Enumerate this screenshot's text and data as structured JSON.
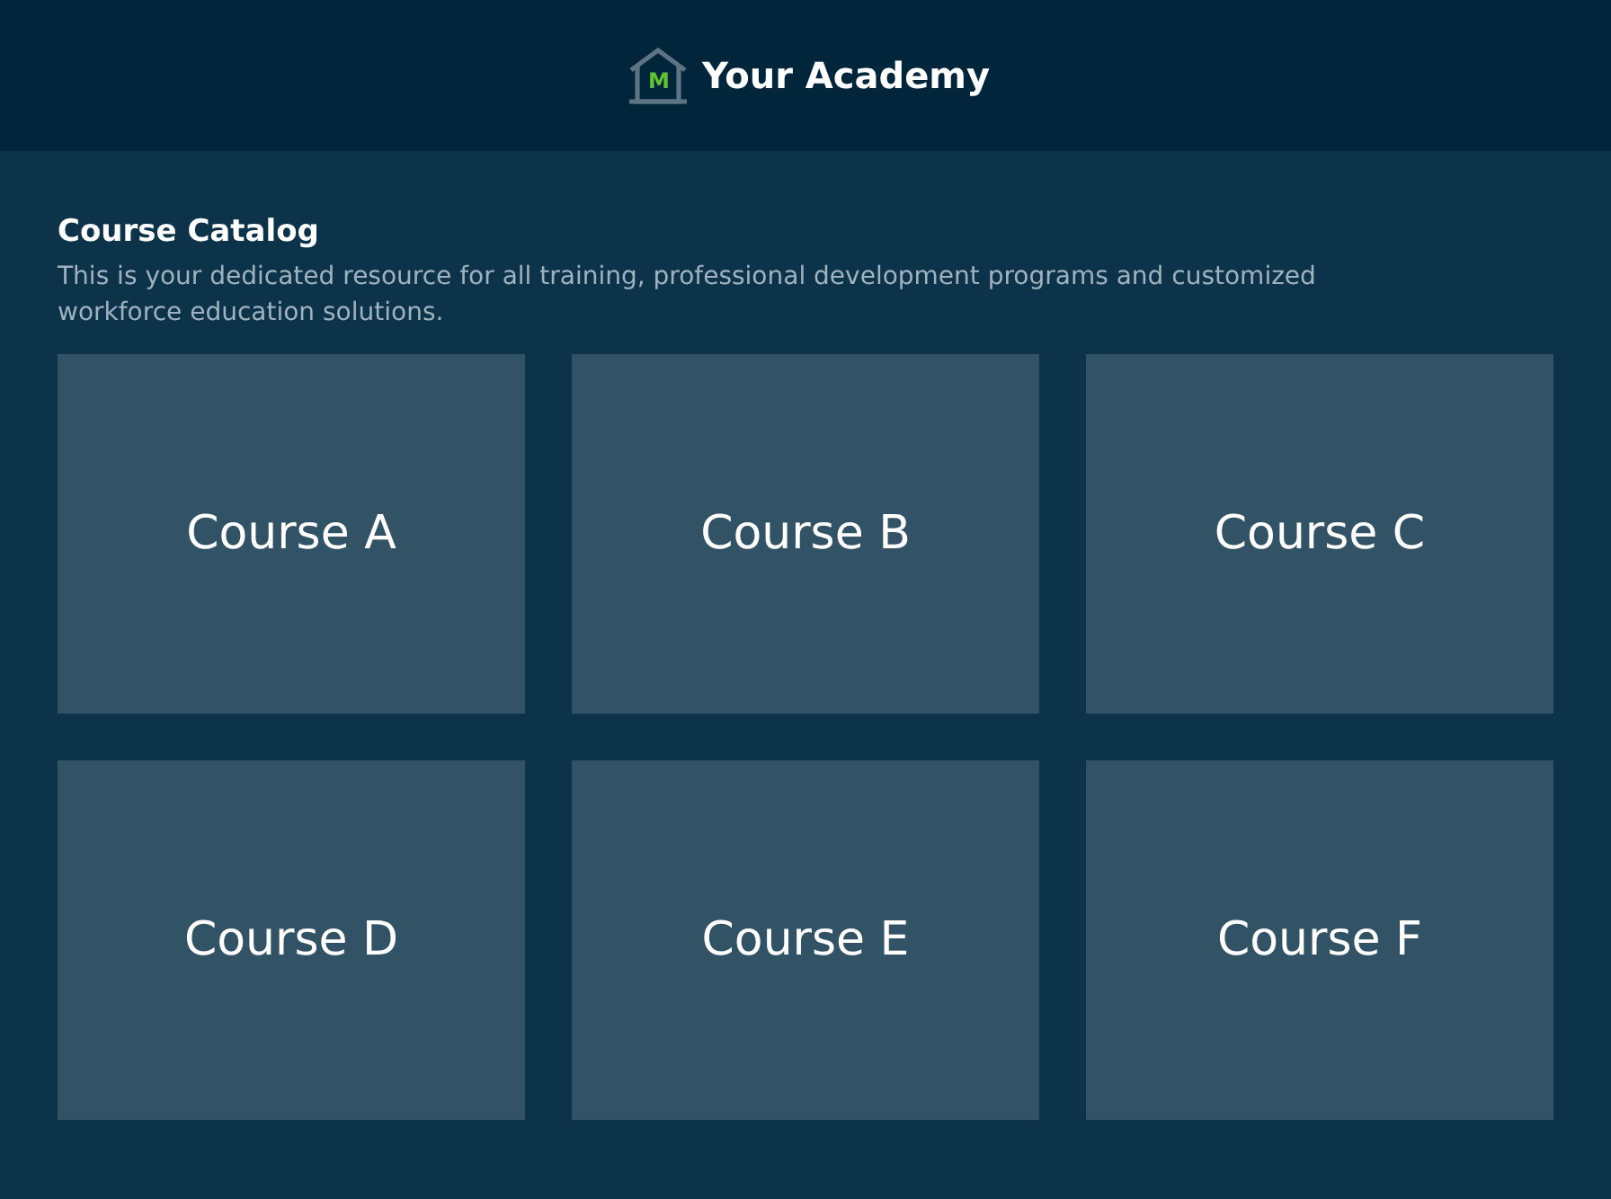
{
  "header": {
    "logo_letter": "M",
    "title": "Your Academy"
  },
  "catalog": {
    "title": "Course Catalog",
    "description": "This is your dedicated resource for all training, professional development programs and customized workforce education solutions."
  },
  "courses": [
    {
      "title": "Course A"
    },
    {
      "title": "Course B"
    },
    {
      "title": "Course C"
    },
    {
      "title": "Course D"
    },
    {
      "title": "Course E"
    },
    {
      "title": "Course F"
    }
  ]
}
